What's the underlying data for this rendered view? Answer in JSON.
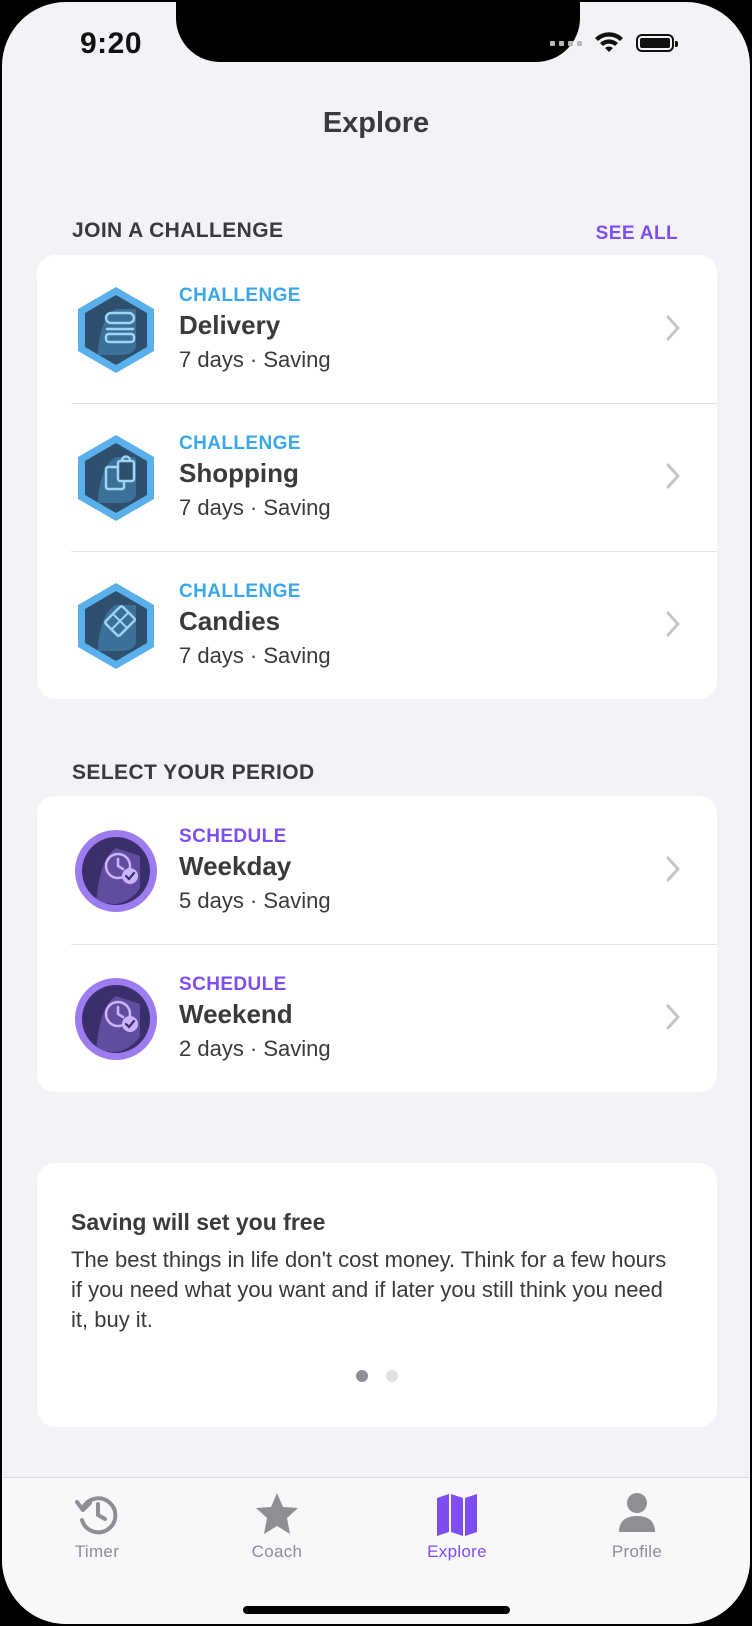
{
  "status": {
    "time": "9:20"
  },
  "nav": {
    "title": "Explore"
  },
  "challenges": {
    "heading": "JOIN A CHALLENGE",
    "see_all": "SEE ALL",
    "items": [
      {
        "kicker": "CHALLENGE",
        "title": "Delivery",
        "meta": "7 days · Saving",
        "icon": "burger-icon"
      },
      {
        "kicker": "CHALLENGE",
        "title": "Shopping",
        "meta": "7 days · Saving",
        "icon": "shopping-bags-icon"
      },
      {
        "kicker": "CHALLENGE",
        "title": "Candies",
        "meta": "7 days · Saving",
        "icon": "chocolate-icon"
      }
    ]
  },
  "period": {
    "heading": "SELECT YOUR PERIOD",
    "items": [
      {
        "kicker": "SCHEDULE",
        "title": "Weekday",
        "meta": "5 days · Saving",
        "icon": "clock-check-icon"
      },
      {
        "kicker": "SCHEDULE",
        "title": "Weekend",
        "meta": "2 days · Saving",
        "icon": "clock-check-icon"
      }
    ]
  },
  "tip": {
    "title": "Saving will set you free",
    "body": "The best things in life don't cost money. Think for a few hours if you need what you want and if later you still think you need it, buy it.",
    "page_count": 2,
    "active_page": 1
  },
  "tabs": [
    {
      "label": "Timer",
      "icon": "history-clock-icon",
      "active": false
    },
    {
      "label": "Coach",
      "icon": "star-icon",
      "active": false
    },
    {
      "label": "Explore",
      "icon": "map-icon",
      "active": true
    },
    {
      "label": "Profile",
      "icon": "person-icon",
      "active": false
    }
  ],
  "colors": {
    "accent_purple": "#7d4ef0",
    "challenge_blue": "#3aa8e8",
    "background": "#f2f2f7"
  }
}
